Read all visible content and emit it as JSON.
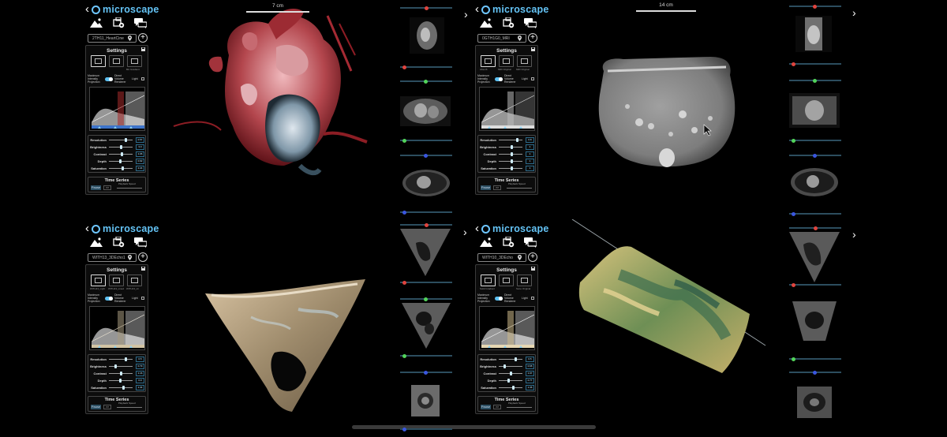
{
  "app": {
    "name": "microscape",
    "accent": "#64c3f5"
  },
  "icons": [
    "back-icon",
    "mountain-image-icon",
    "folder-share-icon",
    "chat-bubbles-icon",
    "pin-icon",
    "add-icon",
    "save-icon",
    "chevron-right-icon"
  ],
  "quadrants": [
    {
      "file": "2TH11_HeartCine",
      "scale": "7 cm",
      "transfer_labels": [
        "",
        "",
        "Bin Gradient"
      ],
      "modes": {
        "mip": "Maximum Intensity Projection",
        "dvr": "Direct Volume Renderer",
        "light": "Light"
      },
      "settings_title": "Settings",
      "sliders": [
        {
          "label": "Resolution",
          "value": "0.57",
          "level": 0.72
        },
        {
          "label": "Brightness",
          "value": "3.0",
          "level": 0.5
        },
        {
          "label": "Contrast",
          "value": "1.06",
          "level": 0.52
        },
        {
          "label": "Depth",
          "value": "0.92",
          "level": 0.45
        },
        {
          "label": "Saturation",
          "value": "2.24",
          "level": 0.58
        }
      ],
      "time_series": {
        "title": "Time Series",
        "pause": "Pause",
        "ff": ">>",
        "speed": "Playback Speed"
      }
    },
    {
      "file": "0GTH1G0_MRI",
      "scale": "14 cm",
      "transfer_labels": [
        "Absorb",
        "MRI Original",
        "MRI Original"
      ],
      "modes": {
        "mip": "Maximum Intensity Projection",
        "dvr": "Direct Volume Renderer",
        "light": "Light"
      },
      "settings_title": "Settings",
      "sliders": [
        {
          "label": "Resolution",
          "value": "0.8",
          "level": 0.78
        },
        {
          "label": "Brightness",
          "value": "1",
          "level": 0.52
        },
        {
          "label": "Contrast",
          "value": "1",
          "level": 0.52
        },
        {
          "label": "Depth",
          "value": "1",
          "level": 0.52
        },
        {
          "label": "Saturation",
          "value": "1",
          "level": 0.52
        }
      ],
      "time_series": {
        "title": "Time Series",
        "pause": "Pause",
        "ff": ">>",
        "speed": "Playback Speed"
      }
    },
    {
      "file": "WITH13_3DEcho1",
      "scale": "",
      "transfer_labels": [
        "WITH13_Light",
        "WITH13_Lined",
        "WITH13_Hi"
      ],
      "modes": {
        "mip": "Maximum Intensity Projection",
        "dvr": "Direct Volume Renderer",
        "light": "Light"
      },
      "settings_title": "Settings",
      "sliders": [
        {
          "label": "Resolution",
          "value": "0.5",
          "level": 0.72
        },
        {
          "label": "Brightness",
          "value": "0.79",
          "level": 0.25
        },
        {
          "label": "Contrast",
          "value": "1.16",
          "level": 0.5
        },
        {
          "label": "Depth",
          "value": "0.9",
          "level": 0.45
        },
        {
          "label": "Saturation",
          "value": "1.34",
          "level": 0.6
        }
      ],
      "time_series": {
        "title": "Time Series",
        "pause": "Pause",
        "ff": ">>",
        "speed": "Playback Speed"
      }
    },
    {
      "file": "WITH10_3DEcho",
      "scale": "",
      "transfer_labels": [
        "Solid Gradient",
        "",
        "Sono Original"
      ],
      "modes": {
        "mip": "Maximum Intensity Projection",
        "dvr": "Direct Volume Renderer",
        "light": "Light"
      },
      "settings_title": "Settings",
      "sliders": [
        {
          "label": "Resolution",
          "value": "0.5",
          "level": 0.72
        },
        {
          "label": "Brightness",
          "value": "0.68",
          "level": 0.22
        },
        {
          "label": "Contrast",
          "value": "1.07",
          "level": 0.5
        },
        {
          "label": "Depth",
          "value": "0.77",
          "level": 0.38
        },
        {
          "label": "Saturation",
          "value": "1.36",
          "level": 0.6
        }
      ],
      "time_series": {
        "title": "Time Series",
        "pause": "Pause",
        "ff": ">>",
        "speed": "Playback Speed"
      }
    }
  ]
}
